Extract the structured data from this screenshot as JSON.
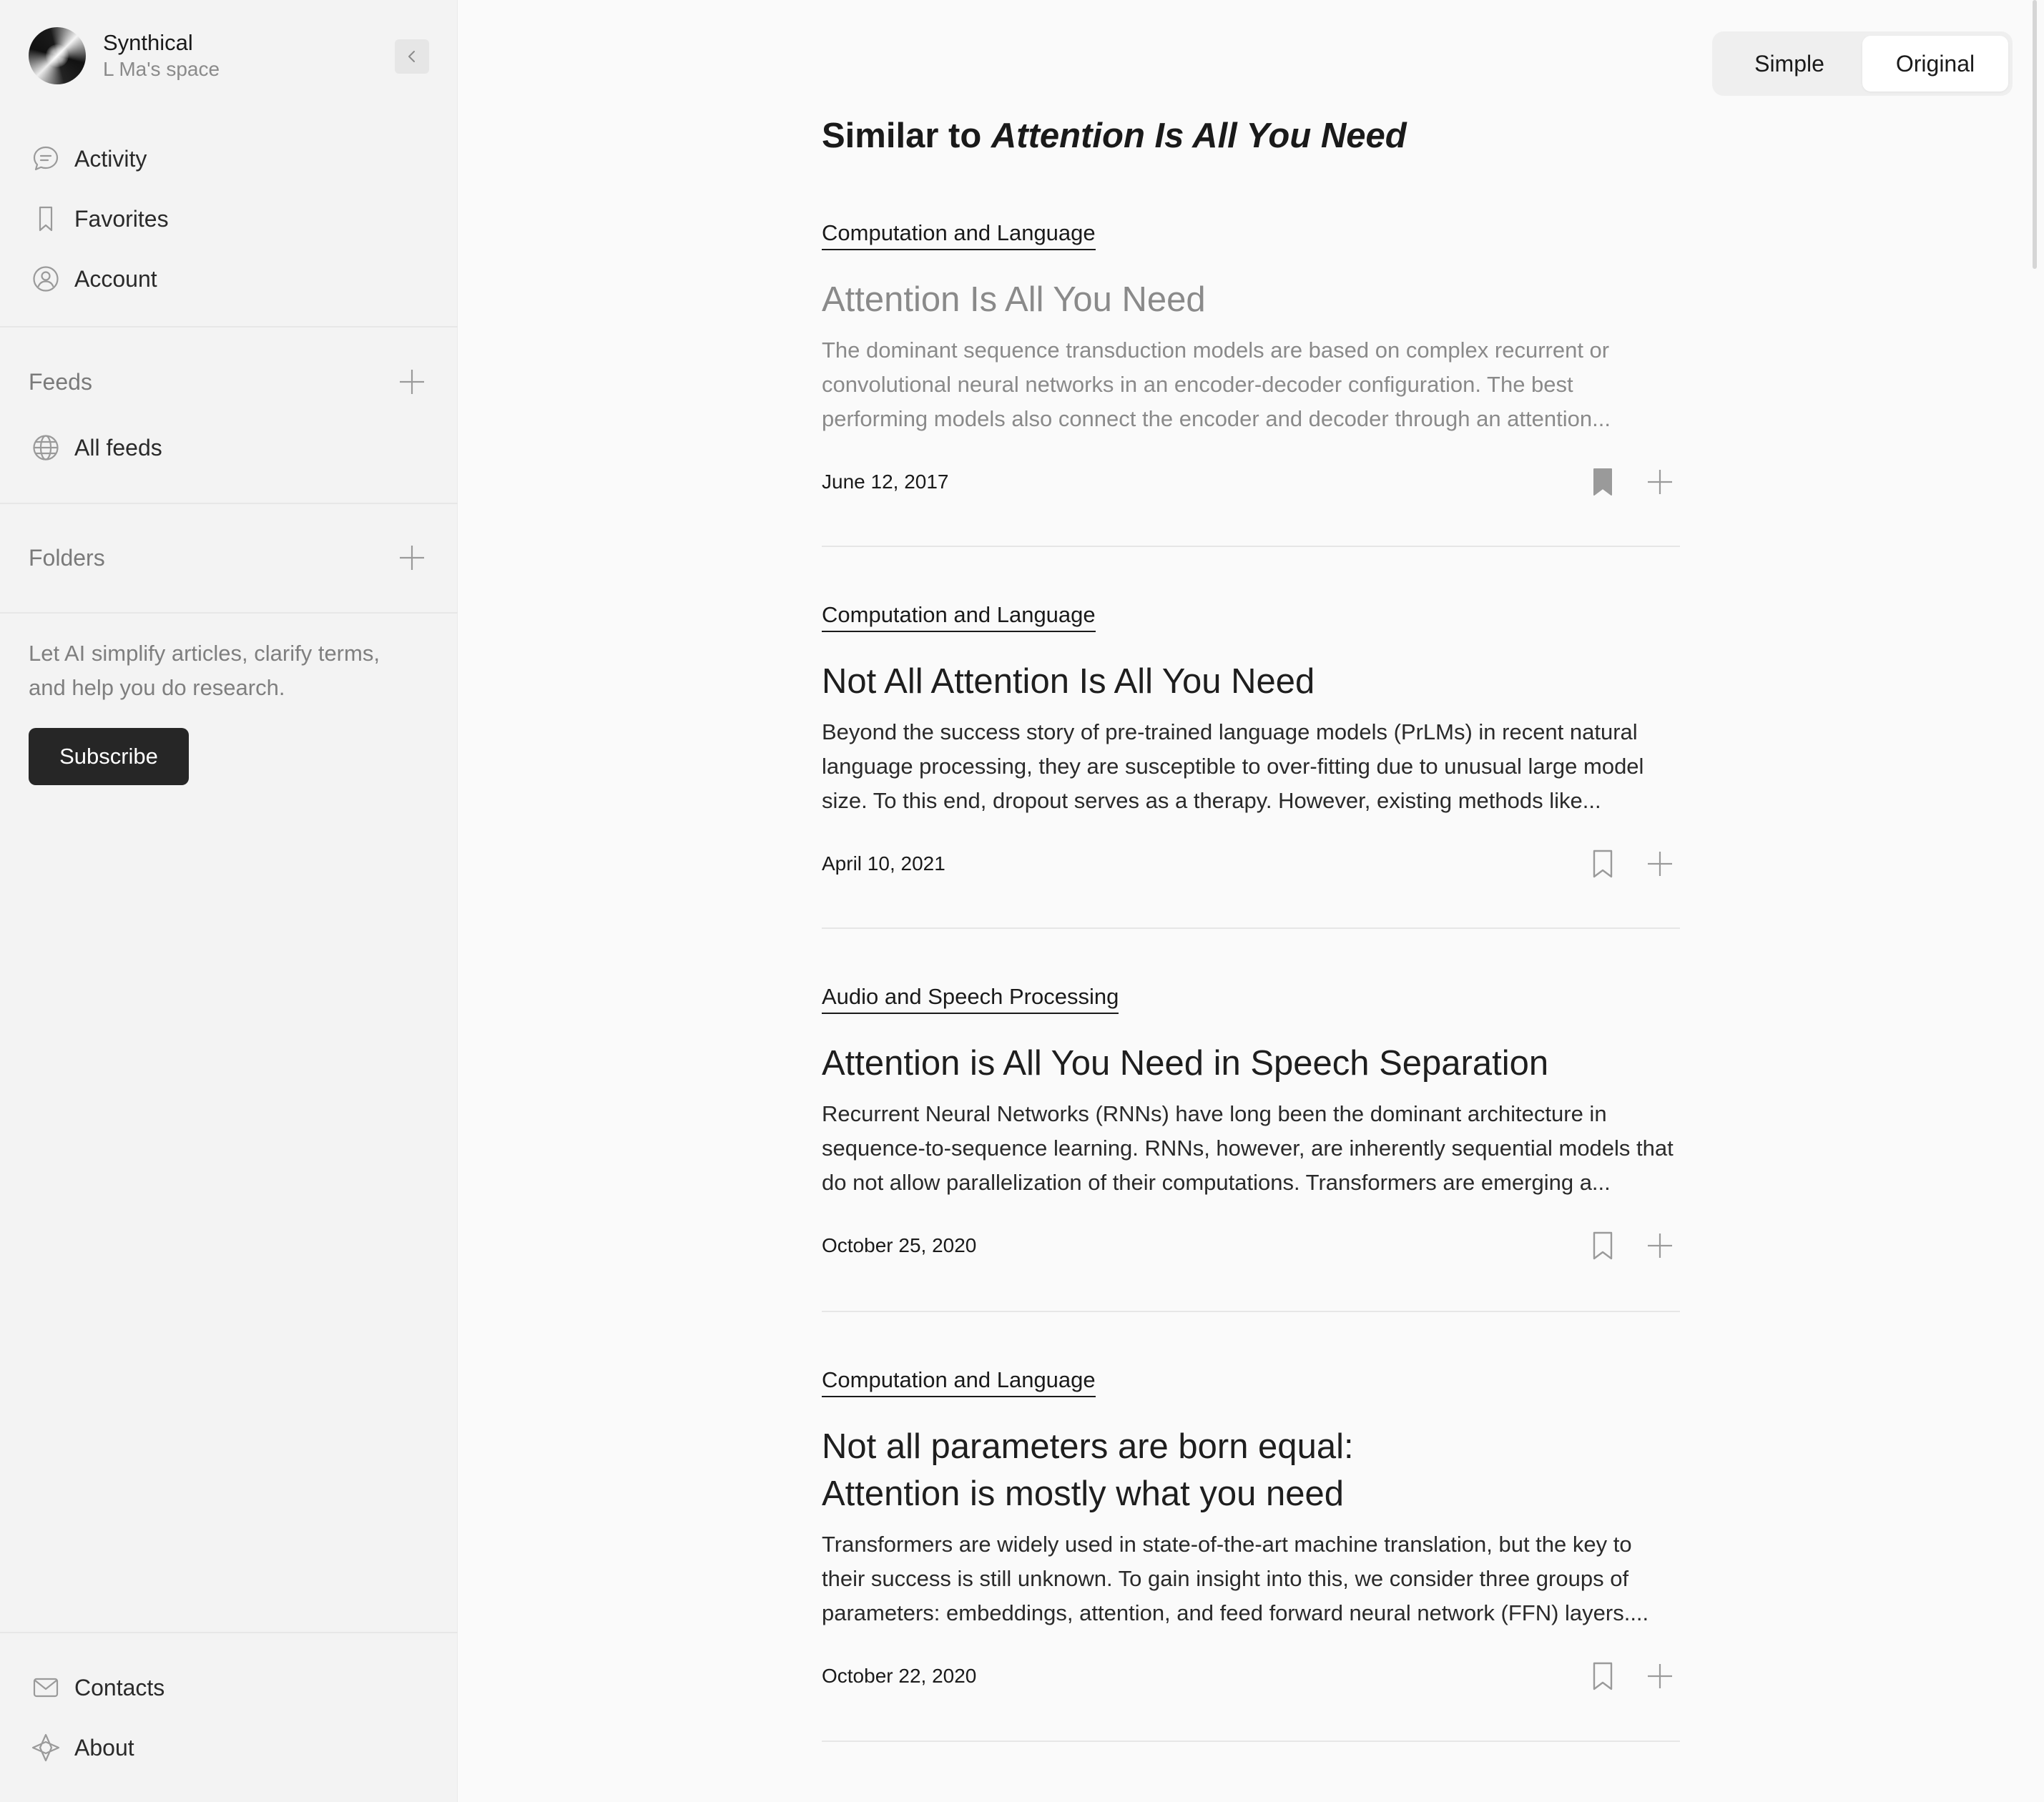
{
  "app": {
    "name": "Synthical",
    "space": "L Ma's space"
  },
  "sidebar": {
    "nav": [
      {
        "label": "Activity",
        "icon": "chat-bubble-icon"
      },
      {
        "label": "Favorites",
        "icon": "bookmark-icon"
      },
      {
        "label": "Account",
        "icon": "user-circle-icon"
      }
    ],
    "feeds": {
      "heading": "Feeds",
      "items": [
        {
          "label": "All feeds",
          "icon": "globe-icon"
        }
      ]
    },
    "folders": {
      "heading": "Folders"
    },
    "promo": "Let AI simplify articles, clarify terms, and help you do research.",
    "subscribe_label": "Subscribe",
    "bottom": [
      {
        "label": "Contacts",
        "icon": "mail-icon"
      },
      {
        "label": "About",
        "icon": "diamond-icon"
      }
    ]
  },
  "view_toggle": {
    "options": [
      "Simple",
      "Original"
    ],
    "selected": "Original"
  },
  "main": {
    "title_prefix": "Similar to",
    "title_subject": "Attention Is All You Need",
    "articles": [
      {
        "category": "Computation and Language",
        "title": "Attention Is All You Need",
        "abstract": "The dominant sequence transduction models are based on complex recurrent or convolutional neural networks in an encoder-decoder configuration. The best performing models also connect the encoder and decoder through an attention...",
        "date": "June 12, 2017",
        "bookmarked": true,
        "read": true
      },
      {
        "category": "Computation and Language",
        "title": "Not All Attention Is All You Need",
        "abstract": "Beyond the success story of pre-trained language models (PrLMs) in recent natural language processing, they are susceptible to over-fitting due to unusual large model size. To this end, dropout serves as a therapy. However, existing methods like...",
        "date": "April 10, 2021",
        "bookmarked": false,
        "read": false
      },
      {
        "category": "Audio and Speech Processing",
        "title": "Attention is All You Need in Speech Separation",
        "abstract": "Recurrent Neural Networks (RNNs) have long been the dominant architecture in sequence-to-sequence learning. RNNs, however, are inherently sequential models that do not allow parallelization of their computations. Transformers are emerging a...",
        "date": "October 25, 2020",
        "bookmarked": false,
        "read": false
      },
      {
        "category": "Computation and Language",
        "title": "Not all parameters are born equal:\nAttention is mostly what you need",
        "abstract": "Transformers are widely used in state-of-the-art machine translation, but the key to their success is still unknown. To gain insight into this, we consider three groups of parameters: embeddings, attention, and feed forward neural network (FFN) layers....",
        "date": "October 22, 2020",
        "bookmarked": false,
        "read": false
      }
    ]
  }
}
